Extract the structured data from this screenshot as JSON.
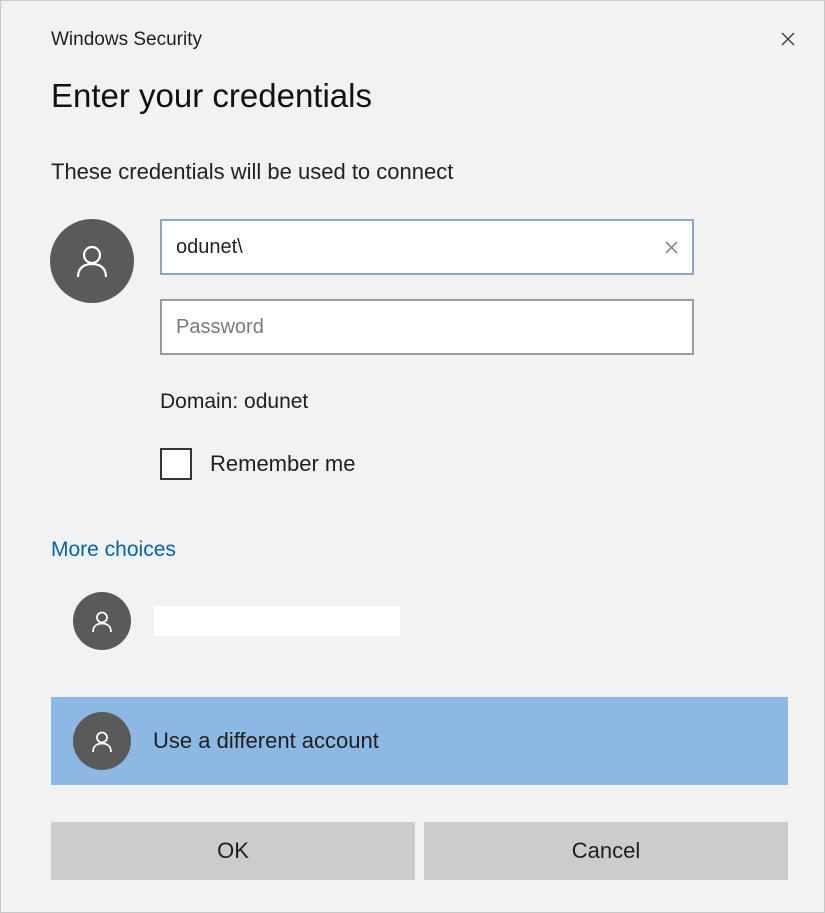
{
  "window": {
    "title": "Windows Security"
  },
  "icons": {
    "close": "close-icon",
    "user": "user-icon",
    "clear": "clear-icon"
  },
  "header": {
    "heading": "Enter your credentials",
    "subtext": "These credentials will be used to connect"
  },
  "form": {
    "username_value": "odunet\\",
    "password_placeholder": "Password",
    "domain_text": "Domain: odunet",
    "remember_label": "Remember me",
    "remember_checked": false
  },
  "choices": {
    "link_label": "More choices",
    "different_account_label": "Use a different account",
    "selected_color": "#8cb8e3"
  },
  "buttons": {
    "ok_label": "OK",
    "cancel_label": "Cancel"
  },
  "colors": {
    "link": "#0063b1",
    "avatar": "#5a5a5a",
    "button": "#cccccc",
    "dialog_bg": "#f2f2f2"
  }
}
